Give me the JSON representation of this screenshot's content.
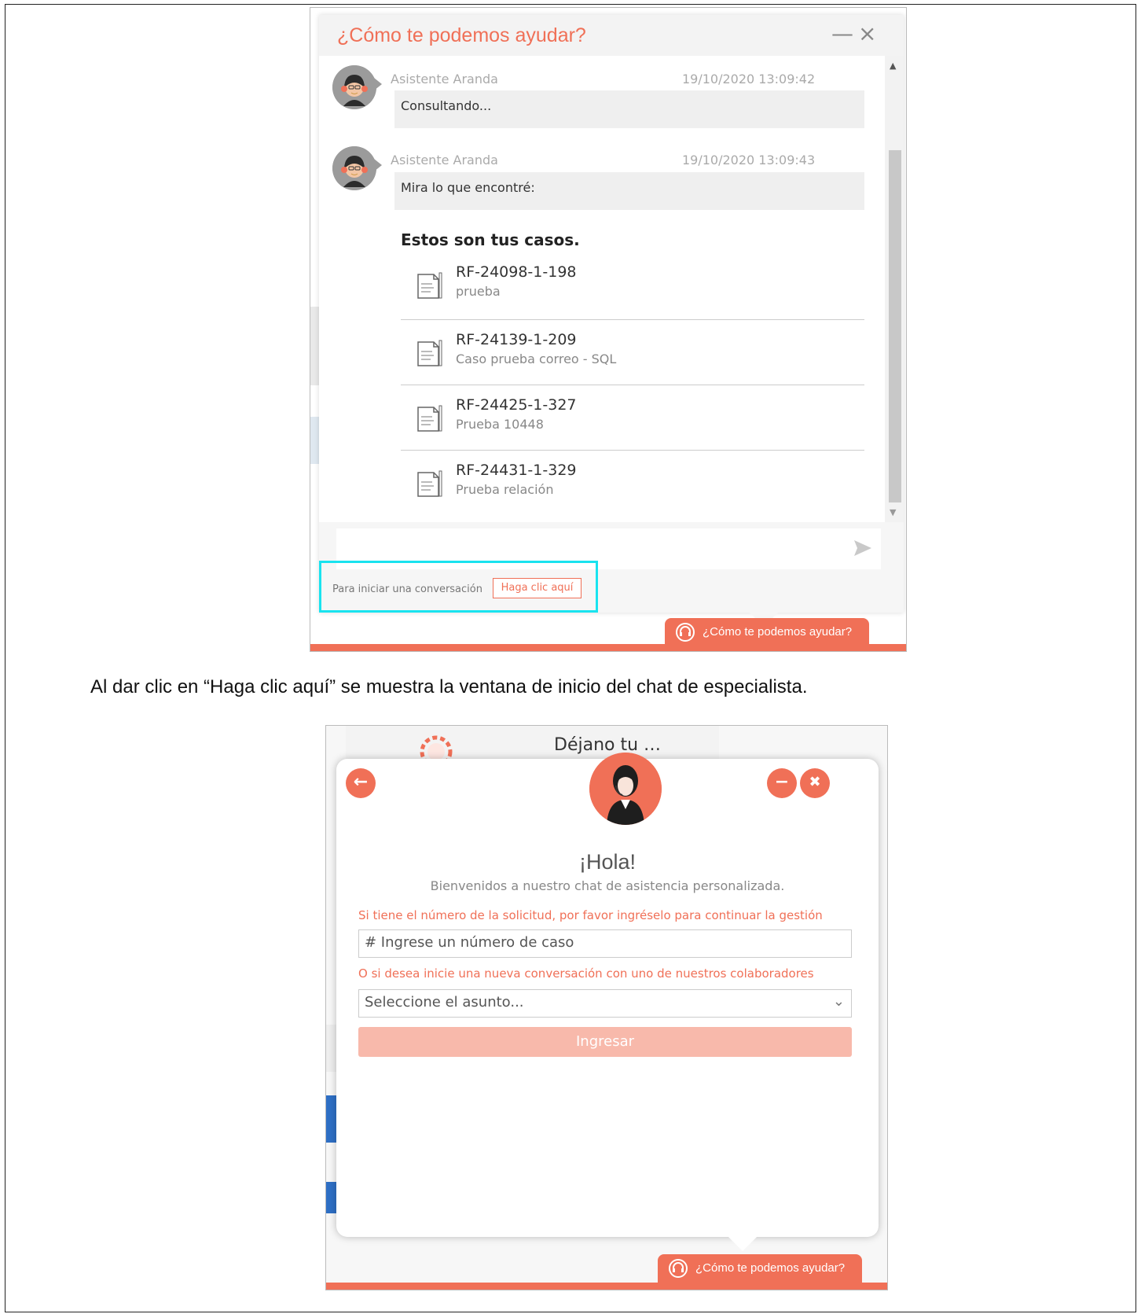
{
  "top_chat": {
    "title": "¿Cómo te podemos ayudar?",
    "minimize_symbol": "—",
    "close_symbol": "×",
    "messages": [
      {
        "sender": "Asistente Aranda",
        "time": "19/10/2020 13:09:42",
        "text": "Consultando..."
      },
      {
        "sender": "Asistente Aranda",
        "time": "19/10/2020 13:09:43",
        "text": "Mira lo que encontré:"
      }
    ],
    "cases_title": "Estos son tus casos.",
    "cases": [
      {
        "id": "RF-24098-1-198",
        "desc": "prueba"
      },
      {
        "id": "RF-24139-1-209",
        "desc": "Caso prueba correo - SQL"
      },
      {
        "id": "RF-24425-1-327",
        "desc": "Prueba 10448"
      },
      {
        "id": "RF-24431-1-329",
        "desc": "Prueba relación"
      }
    ],
    "footer_text": "Para iniciar una conversación",
    "haga_clic_label": "Haga clic aquí",
    "help_tab_label": "¿Cómo te podemos ayudar?",
    "icons": [
      "avatar-icon",
      "document-icon",
      "send-icon",
      "headset-icon"
    ]
  },
  "caption": "Al dar clic en “Haga clic aquí” se muestra la ventana de inicio del chat de especialista.",
  "bottom_chat": {
    "bg_text": "Déjano tu …",
    "greeting": "¡Hola!",
    "welcome": "Bienvenidos a nuestro chat de asistencia personalizada.",
    "case_label": "Si tiene el número de la solicitud, por favor ingréselo para continuar la gestión",
    "case_placeholder": "# Ingrese un número de caso",
    "new_conv_label": "O si desea inicie una nueva conversación con uno de nuestros colaboradores",
    "subject_placeholder": "Seleccione el asunto...",
    "submit_label": "Ingresar",
    "help_tab_label": "¿Cómo te podemos ayudar?",
    "back_symbol": "←",
    "minimize_symbol": "−",
    "close_symbol": "✖"
  },
  "colors": {
    "accent": "#f07057",
    "highlight": "#19e3ef",
    "button_disabled": "#f8b9ab"
  }
}
